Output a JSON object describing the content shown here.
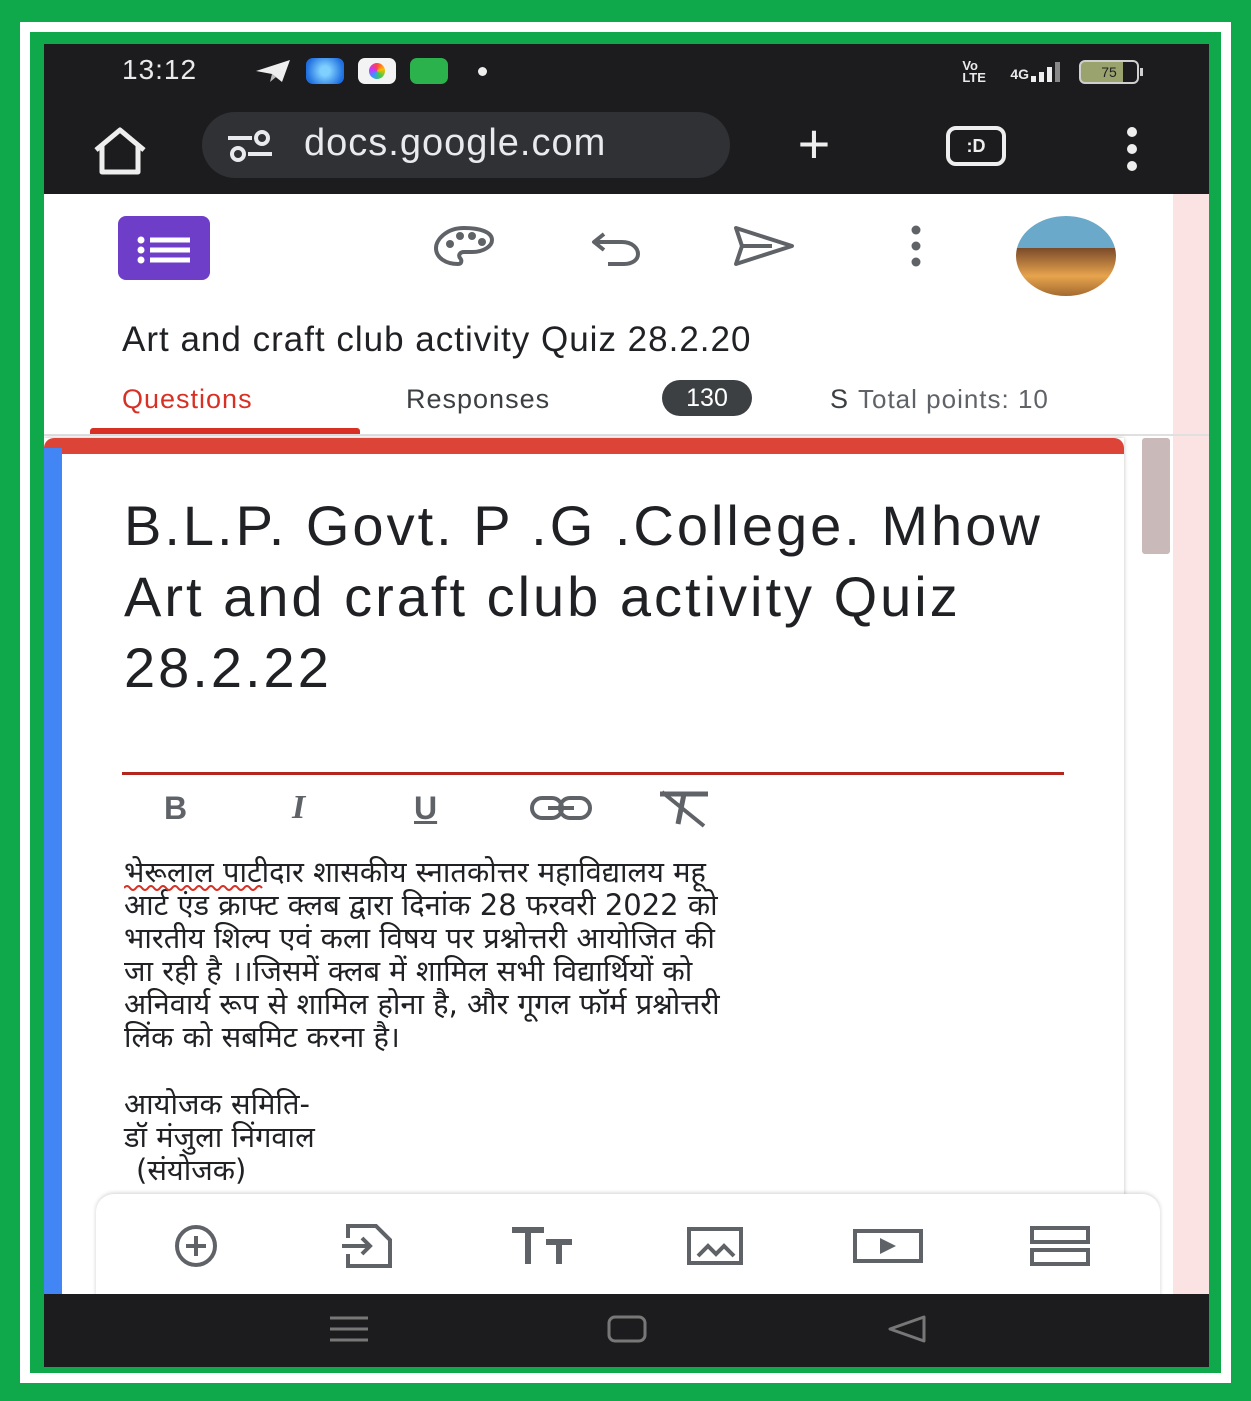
{
  "status_bar": {
    "time": "13:12",
    "network_label": "Vo LTE",
    "signal_label": "4G",
    "battery": "75",
    "app_icons": [
      "telegram-icon",
      "app-blue-icon",
      "app-white-icon",
      "app-green-icon"
    ]
  },
  "browser": {
    "url": "docs.google.com",
    "tabs_label": ":D"
  },
  "form_header": {
    "title": "Art and craft club activity Quiz 28.2.20",
    "tabs": {
      "questions": "Questions",
      "responses": "Responses",
      "responses_count": "130",
      "settings": "S",
      "total_points": "Total points: 10"
    }
  },
  "form_card": {
    "title": "B.L.P. Govt. P .G .College. Mhow Art and craft club activity Quiz 28.2.22",
    "format_buttons": [
      "B",
      "I",
      "U",
      "link-icon",
      "clear-format-icon"
    ],
    "description_lines": [
      "भेरूलाल पाटीदार शासकीय स्नातकोत्तर महाविद्यालय महू",
      "आर्ट एंड क्राफ्ट क्लब द्वारा दिनांक 28 फरवरी 2022 को",
      "भारतीय शिल्प एवं कला विषय पर प्रश्नोत्तरी आयोजित की",
      "जा रही है ।।जिसमें क्लब में शामिल सभी विद्यार्थियों को",
      "अनिवार्य रूप से शामिल होना है, और गूगल फॉर्म प्रश्नोत्तरी",
      "लिंक को सबमिट करना है।"
    ],
    "organizer_lines": {
      "committee": "आयोजक समिति-",
      "name": "डॉ मंजुला निंगवाल",
      "role": "(संयोजक)"
    }
  },
  "colors": {
    "accent_red": "#d93025",
    "forms_purple": "#6f3ec9",
    "card_left": "#4285f4",
    "frame_green": "#0fa84a"
  }
}
